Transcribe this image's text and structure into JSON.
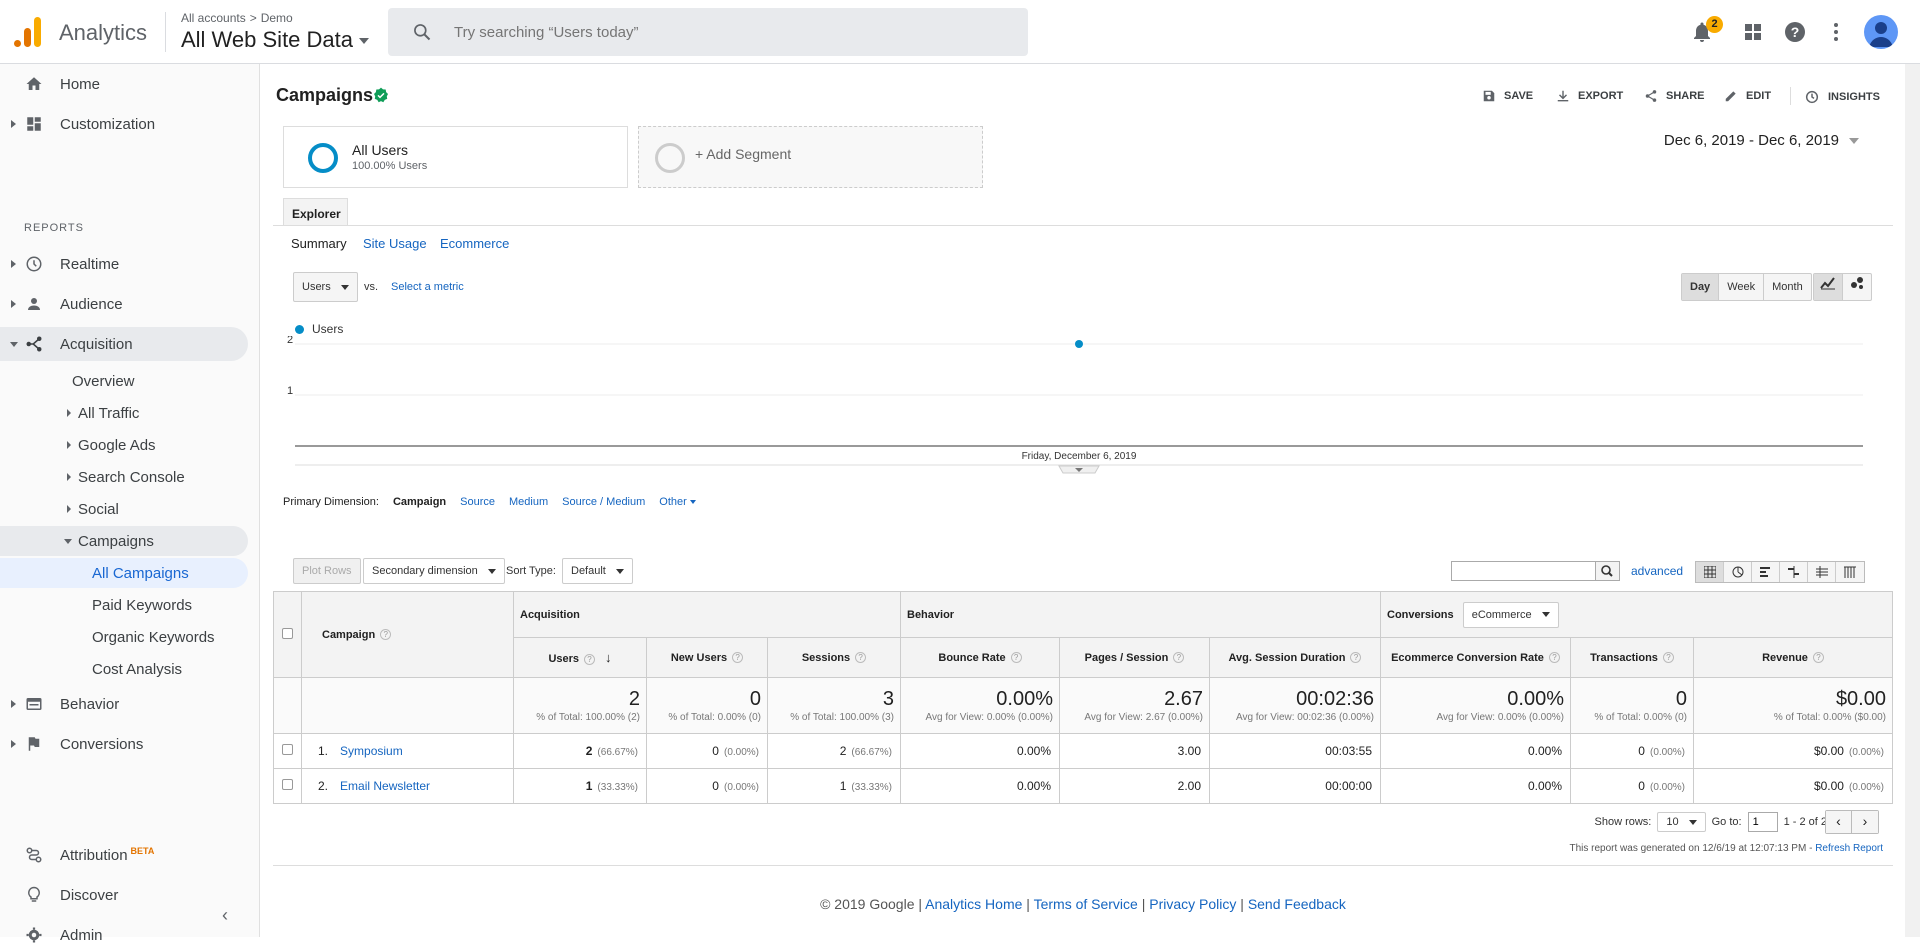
{
  "topbar": {
    "app_name": "Analytics",
    "breadcrumb_account": "All accounts",
    "breadcrumb_property": "Demo",
    "view_name": "All Web Site Data",
    "search_placeholder": "Try searching “Users today”",
    "notification_count": "2"
  },
  "sidebar": {
    "home": "Home",
    "customization": "Customization",
    "reports_label": "REPORTS",
    "realtime": "Realtime",
    "audience": "Audience",
    "acquisition": "Acquisition",
    "acq_items": [
      "Overview",
      "All Traffic",
      "Google Ads",
      "Search Console",
      "Social",
      "Campaigns"
    ],
    "campaign_items": [
      "All Campaigns",
      "Paid Keywords",
      "Organic Keywords",
      "Cost Analysis"
    ],
    "behavior": "Behavior",
    "conversions": "Conversions",
    "attribution": "Attribution",
    "attribution_badge": "BETA",
    "discover": "Discover",
    "admin": "Admin"
  },
  "header": {
    "title": "Campaigns",
    "actions": [
      "SAVE",
      "EXPORT",
      "SHARE",
      "EDIT",
      "INSIGHTS"
    ]
  },
  "segments": {
    "active_name": "All Users",
    "active_sub": "100.00% Users",
    "add_label": "+ Add Segment",
    "date_range": "Dec 6, 2019 - Dec 6, 2019"
  },
  "explorer": {
    "tab": "Explorer",
    "subtabs": [
      "Summary",
      "Site Usage",
      "Ecommerce"
    ],
    "metric": "Users",
    "vs": "vs.",
    "select_metric": "Select a metric",
    "granularity": [
      "Day",
      "Week",
      "Month"
    ]
  },
  "chart_data": {
    "type": "line",
    "series": [
      {
        "name": "Users",
        "values": [
          2
        ]
      }
    ],
    "x": [
      "Friday, December 6, 2019"
    ],
    "yticks": [
      "2",
      "1"
    ],
    "ylim": [
      0,
      2
    ],
    "color": "#058dc7"
  },
  "dimension": {
    "label": "Primary Dimension:",
    "current": "Campaign",
    "options": [
      "Source",
      "Medium",
      "Source / Medium",
      "Other"
    ]
  },
  "tools": {
    "plot_rows": "Plot Rows",
    "secondary": "Secondary dimension",
    "sort_label": "Sort Type:",
    "sort_value": "Default",
    "advanced": "advanced"
  },
  "table": {
    "dim_header": "Campaign",
    "group_acq": "Acquisition",
    "group_beh": "Behavior",
    "group_conv": "Conversions",
    "conv_select": "eCommerce",
    "columns": [
      "Users",
      "New Users",
      "Sessions",
      "Bounce Rate",
      "Pages / Session",
      "Avg. Session Duration",
      "Ecommerce Conversion Rate",
      "Transactions",
      "Revenue"
    ],
    "totals": [
      {
        "value": "2",
        "sub": "% of Total: 100.00% (2)"
      },
      {
        "value": "0",
        "sub": "% of Total: 0.00% (0)"
      },
      {
        "value": "3",
        "sub": "% of Total: 100.00% (3)"
      },
      {
        "value": "0.00%",
        "sub": "Avg for View: 0.00% (0.00%)"
      },
      {
        "value": "2.67",
        "sub": "Avg for View: 2.67 (0.00%)"
      },
      {
        "value": "00:02:36",
        "sub": "Avg for View: 00:02:36 (0.00%)"
      },
      {
        "value": "0.00%",
        "sub": "Avg for View: 0.00% (0.00%)"
      },
      {
        "value": "0",
        "sub": "% of Total: 0.00% (0)"
      },
      {
        "value": "$0.00",
        "sub": "% of Total: 0.00% ($0.00)"
      }
    ],
    "rows": [
      {
        "idx": "1.",
        "name": "Symposium",
        "users": "2",
        "users_pct": "(66.67%)",
        "new": "0",
        "new_pct": "(0.00%)",
        "sessions": "2",
        "sessions_pct": "(66.67%)",
        "bounce": "0.00%",
        "pages": "3.00",
        "dur": "00:03:55",
        "conv": "0.00%",
        "trans": "0",
        "trans_pct": "(0.00%)",
        "rev": "$0.00",
        "rev_pct": "(0.00%)"
      },
      {
        "idx": "2.",
        "name": "Email Newsletter",
        "users": "1",
        "users_pct": "(33.33%)",
        "new": "0",
        "new_pct": "(0.00%)",
        "sessions": "1",
        "sessions_pct": "(33.33%)",
        "bounce": "0.00%",
        "pages": "2.00",
        "dur": "00:00:00",
        "conv": "0.00%",
        "trans": "0",
        "trans_pct": "(0.00%)",
        "rev": "$0.00",
        "rev_pct": "(0.00%)"
      }
    ]
  },
  "pager": {
    "show_rows": "Show rows:",
    "rows_value": "10",
    "goto": "Go to:",
    "goto_value": "1",
    "range": "1 - 2 of 2",
    "generated": "This report was generated on 12/6/19 at 12:07:13 PM -",
    "refresh": "Refresh Report"
  },
  "footer": {
    "copyright": "© 2019 Google |",
    "links": [
      "Analytics Home",
      "Terms of Service",
      "Privacy Policy",
      "Send Feedback"
    ]
  }
}
